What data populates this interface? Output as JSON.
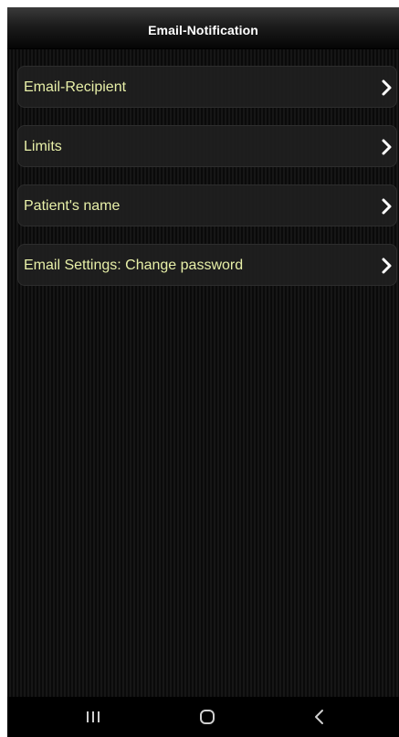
{
  "header": {
    "title": "Email-Notification"
  },
  "menu": {
    "items": [
      {
        "label": "Email-Recipient",
        "icon": "chevron-right-icon"
      },
      {
        "label": "Limits",
        "icon": "chevron-right-icon"
      },
      {
        "label": "Patient's name",
        "icon": "chevron-right-icon"
      },
      {
        "label": "Email Settings: Change password",
        "icon": "chevron-right-icon"
      }
    ]
  },
  "navigation": {
    "buttons": [
      {
        "name": "recent-apps-icon"
      },
      {
        "name": "home-icon"
      },
      {
        "name": "back-icon"
      }
    ]
  },
  "colors": {
    "label_text": "#e8f0a8",
    "title_text": "#ffffff",
    "background": "#0b0b0b"
  }
}
